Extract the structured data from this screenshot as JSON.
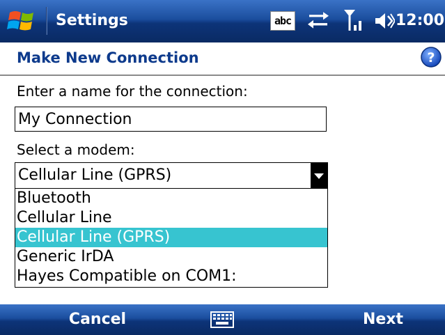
{
  "titlebar": {
    "app_title": "Settings",
    "input_mode": "abc",
    "time": "12:00",
    "icons": [
      "windows-start-icon",
      "abc-input-icon",
      "sync-arrows-icon",
      "signal-strength-icon",
      "volume-icon"
    ]
  },
  "header": {
    "page_title": "Make New Connection",
    "help_icon": "help-icon"
  },
  "form": {
    "name_label": "Enter a name for the connection:",
    "name_value": "My Connection",
    "modem_label": "Select a modem:",
    "modem_selected": "Cellular Line (GPRS)",
    "modem_options": [
      "Bluetooth",
      "Cellular Line",
      "Cellular Line (GPRS)",
      "Generic IrDA",
      "Hayes Compatible on COM1:"
    ],
    "highlighted_option_index": 2
  },
  "softkeys": {
    "left": "Cancel",
    "right": "Next",
    "center_icon": "keyboard-icon"
  },
  "colors": {
    "bar_blue": "#1b4e9e",
    "title_blue": "#0d3a8c",
    "highlight": "#37c4d0"
  }
}
